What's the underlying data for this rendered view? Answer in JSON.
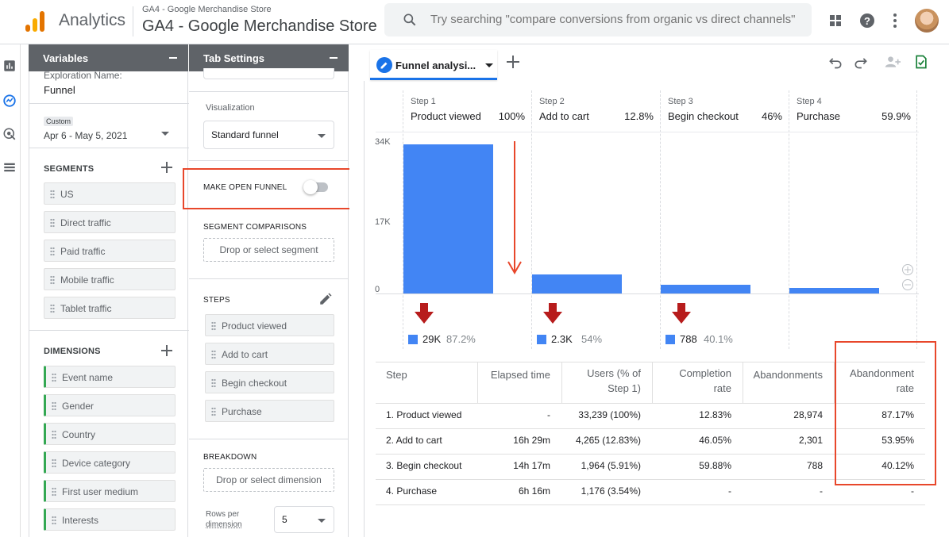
{
  "header": {
    "app_name": "Analytics",
    "property_small": "GA4 - Google Merchandise Store",
    "property_big": "GA4 - Google Merchandise Store",
    "search_placeholder": "Try searching \"compare conversions from organic vs direct channels\""
  },
  "variables_panel": {
    "title": "Variables",
    "exploration_name_label": "Exploration Name:",
    "exploration_name": "Funnel",
    "date_badge": "Custom",
    "date_range": "Apr 6 - May 5, 2021",
    "segments_label": "SEGMENTS",
    "segments": [
      "US",
      "Direct traffic",
      "Paid traffic",
      "Mobile traffic",
      "Tablet traffic"
    ],
    "dimensions_label": "DIMENSIONS",
    "dimensions": [
      "Event name",
      "Gender",
      "Country",
      "Device category",
      "First user medium",
      "Interests"
    ]
  },
  "tab_settings": {
    "title": "Tab Settings",
    "visualization_label": "Visualization",
    "visualization_value": "Standard funnel",
    "open_funnel_label": "MAKE OPEN FUNNEL",
    "open_funnel_enabled": false,
    "segment_comparisons_label": "SEGMENT COMPARISONS",
    "segment_drop": "Drop or select segment",
    "steps_label": "STEPS",
    "steps": [
      "Product viewed",
      "Add to cart",
      "Begin checkout",
      "Purchase"
    ],
    "breakdown_label": "BREAKDOWN",
    "dimension_drop": "Drop or select dimension",
    "rows_per_dimension_label_1": "Rows per",
    "rows_per_dimension_label_2": "dimension",
    "rows_per_dimension_value": "5"
  },
  "tab": {
    "title": "Funnel analysi..."
  },
  "colors": {
    "accent": "#1a73e8",
    "bar": "#4285f4",
    "highlight": "#e8472b",
    "drop_arrow": "#b71c1c",
    "dimension_chip": "#34a853"
  },
  "chart_data": {
    "type": "bar",
    "categories": [
      "Product viewed",
      "Add to cart",
      "Begin checkout",
      "Purchase"
    ],
    "step_labels": [
      "Step 1",
      "Step 2",
      "Step 3",
      "Step 4"
    ],
    "step_percents": [
      "100%",
      "12.8%",
      "46%",
      "59.9%"
    ],
    "values": [
      33239,
      4265,
      1964,
      1176
    ],
    "yticks": [
      "34K",
      "17K",
      "0"
    ],
    "ylim": [
      0,
      34000
    ],
    "abandonments": [
      {
        "value": "29K",
        "percent": "87.2%"
      },
      {
        "value": "2.3K",
        "percent": "54%"
      },
      {
        "value": "788",
        "percent": "40.1%"
      }
    ]
  },
  "table": {
    "headers": [
      "Step",
      "Elapsed time",
      "Users (% of Step 1)",
      "Completion rate",
      "Abandonments",
      "Abandonment rate"
    ],
    "header_lines": [
      [
        "Step"
      ],
      [
        "Elapsed time"
      ],
      [
        "Users (% of",
        "Step 1)"
      ],
      [
        "Completion",
        "rate"
      ],
      [
        "Abandonments"
      ],
      [
        "Abandonment",
        "rate"
      ]
    ],
    "rows": [
      [
        "1. Product viewed",
        "-",
        "33,239 (100%)",
        "12.83%",
        "28,974",
        "87.17%"
      ],
      [
        "2. Add to cart",
        "16h 29m",
        "4,265 (12.83%)",
        "46.05%",
        "2,301",
        "53.95%"
      ],
      [
        "3. Begin checkout",
        "14h 17m",
        "1,964 (5.91%)",
        "59.88%",
        "788",
        "40.12%"
      ],
      [
        "4. Purchase",
        "6h 16m",
        "1,176 (3.54%)",
        "-",
        "-",
        "-"
      ]
    ]
  }
}
